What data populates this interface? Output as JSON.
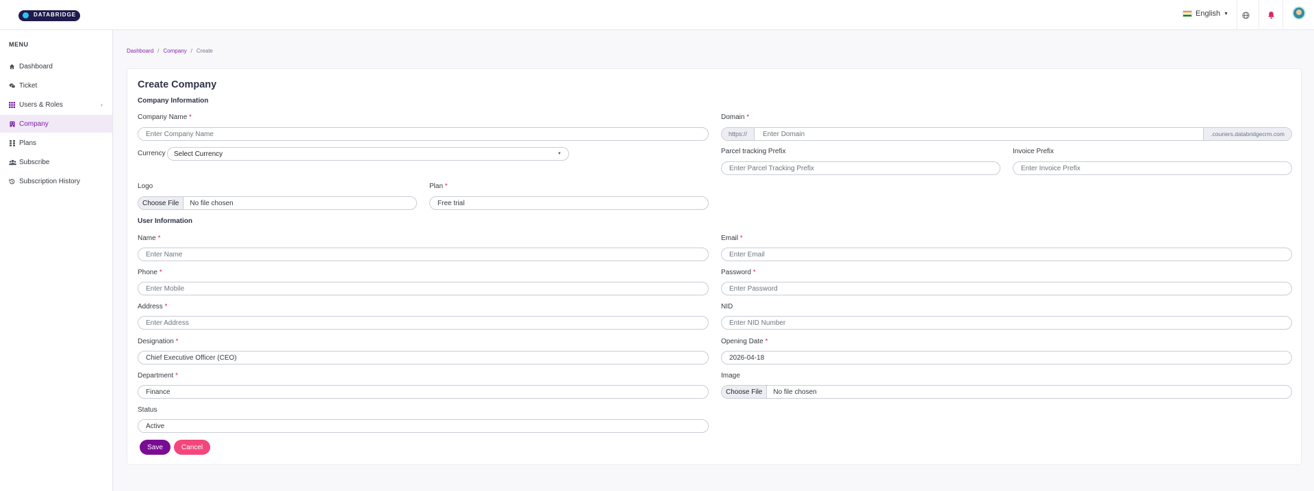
{
  "brand": {
    "name": "DATABRIDGE"
  },
  "topbar": {
    "language": "English"
  },
  "sidebar": {
    "menu_title": "MENU",
    "items": [
      {
        "label": "Dashboard",
        "icon": "home-icon"
      },
      {
        "label": "Ticket",
        "icon": "chat-icon"
      },
      {
        "label": "Users & Roles",
        "icon": "grid-icon"
      },
      {
        "label": "Company",
        "icon": "building-icon",
        "active": true
      },
      {
        "label": "Plans",
        "icon": "dots-grid-icon"
      },
      {
        "label": "Subscribe",
        "icon": "users-icon"
      },
      {
        "label": "Subscription History",
        "icon": "history-icon"
      }
    ]
  },
  "breadcrumb": {
    "dashboard": "Dashboard",
    "company": "Company",
    "create": "Create",
    "sep": "/"
  },
  "form": {
    "title": "Create Company",
    "company_section": "Company Information",
    "user_section": "User Information",
    "company_name": {
      "label": "Company Name",
      "placeholder": "Enter Company Name"
    },
    "domain": {
      "label": "Domain",
      "prefix": "https://",
      "placeholder": "Enter Domain",
      "suffix": ".couriers.databridgecrm.com"
    },
    "currency": {
      "label": "Currency",
      "value": "Select Currency"
    },
    "parcel_prefix": {
      "label": "Parcel tracking Prefix",
      "placeholder": "Enter Parcel Tracking Prefix"
    },
    "invoice_prefix": {
      "label": "Invoice Prefix",
      "placeholder": "Enter Invoice Prefix"
    },
    "logo": {
      "label": "Logo",
      "choose": "Choose File",
      "nofile": "No file chosen"
    },
    "plan": {
      "label": "Plan",
      "value": "Free trial"
    },
    "name": {
      "label": "Name",
      "placeholder": "Enter Name"
    },
    "email": {
      "label": "Email",
      "placeholder": "Enter Email"
    },
    "phone": {
      "label": "Phone",
      "placeholder": "Enter Mobile"
    },
    "password": {
      "label": "Password",
      "placeholder": "Enter Password"
    },
    "address": {
      "label": "Address",
      "placeholder": "Enter Address"
    },
    "nid": {
      "label": "NID",
      "placeholder": "Enter NID Number"
    },
    "designation": {
      "label": "Designation",
      "value": "Chief Executive Officer (CEO)"
    },
    "opening_date": {
      "label": "Opening Date",
      "value": "2026-04-18"
    },
    "department": {
      "label": "Department",
      "value": "Finance"
    },
    "image": {
      "label": "Image",
      "choose": "Choose File",
      "nofile": "No file chosen"
    },
    "status": {
      "label": "Status",
      "value": "Active"
    },
    "required_mark": "*",
    "save": "Save",
    "cancel": "Cancel"
  }
}
